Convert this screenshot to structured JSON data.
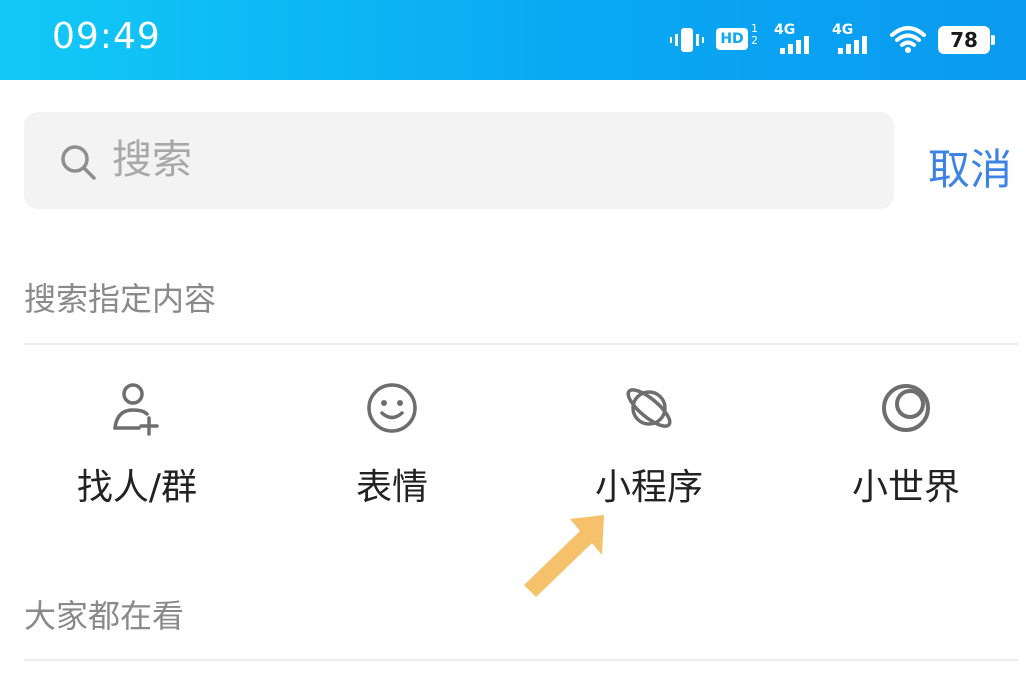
{
  "status_bar": {
    "time": "09:49",
    "icons": [
      "vibrate-icon",
      "hd-icon",
      "signal-4g-icon",
      "signal-4g-icon",
      "wifi-icon"
    ],
    "network_label_1": "4G",
    "network_label_2": "4G",
    "hd_label": "HD",
    "battery": "78"
  },
  "search": {
    "placeholder": "搜索",
    "value": "",
    "cancel_label": "取消"
  },
  "specified": {
    "title": "搜索指定内容",
    "items": [
      {
        "label": "找人/群",
        "icon": "add-person-icon"
      },
      {
        "label": "表情",
        "icon": "smiley-icon"
      },
      {
        "label": "小程序",
        "icon": "mini-program-icon"
      },
      {
        "label": "小世界",
        "icon": "small-world-icon"
      }
    ]
  },
  "trending": {
    "title": "大家都在看"
  },
  "colors": {
    "status_bar_start": "#12c9f6",
    "status_bar_end": "#0a9af0",
    "accent": "#3d83e6",
    "annotation_arrow": "#f5c26b"
  }
}
